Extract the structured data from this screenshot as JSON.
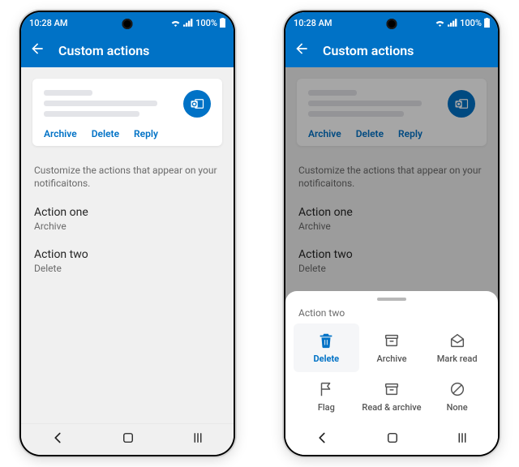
{
  "status": {
    "time": "10:28 AM",
    "battery_pct": "100%"
  },
  "appbar": {
    "title": "Custom actions"
  },
  "preview": {
    "actions": {
      "archive": "Archive",
      "delete": "Delete",
      "reply": "Reply"
    }
  },
  "info": {
    "text": "Customize the actions that appear on your notificaitons."
  },
  "rows": {
    "action_one": {
      "title": "Action one",
      "value": "Archive"
    },
    "action_two": {
      "title": "Action two",
      "value": "Delete"
    }
  },
  "sheet": {
    "title": "Action two",
    "options": {
      "delete": {
        "label": "Delete"
      },
      "archive": {
        "label": "Archive"
      },
      "mark_read": {
        "label": "Mark read"
      },
      "flag": {
        "label": "Flag"
      },
      "read_archive": {
        "label": "Read & archive"
      },
      "none": {
        "label": "None"
      }
    }
  },
  "colors": {
    "brand": "#0072c6"
  }
}
